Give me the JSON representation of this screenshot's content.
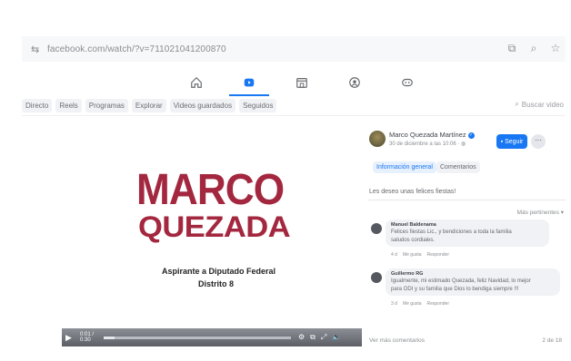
{
  "browser": {
    "url": "facebook.com/watch/?v=711021041200870",
    "icons": [
      "site-settings-icon",
      "install-app-icon",
      "zoom-icon",
      "bookmark-star-icon"
    ]
  },
  "topnav": {
    "items": [
      {
        "icon": "home-icon",
        "active": false
      },
      {
        "icon": "watch-icon",
        "active": true
      },
      {
        "icon": "marketplace-icon",
        "active": false
      },
      {
        "icon": "groups-icon",
        "active": false
      },
      {
        "icon": "gaming-icon",
        "active": false
      }
    ]
  },
  "tabs": {
    "items": [
      "Directo",
      "Reels",
      "Programas",
      "Explorar",
      "Videos guardados",
      "Seguidos"
    ],
    "search_placeholder": "Buscar video"
  },
  "video": {
    "title_line1": "MARCO",
    "title_line2": "QUEZADA",
    "subtitle_line1": "Aspirante a Diputado Federal",
    "subtitle_line2": "Distrito 8",
    "time": "0:01 / 0:30",
    "progress": 0.06,
    "accent_color": "#a3283f"
  },
  "panel": {
    "author": "Marco Quezada Martínez",
    "date": "30 de diciembre a las 10:06 · ",
    "follow_label": "Seguir",
    "more_label": "···",
    "tab_info": "Información general",
    "tab_comments": "Comentarios",
    "description": "Les deseo unas felices fiestas!",
    "sort_label": "Más pertinentes ▾",
    "comments": [
      {
        "name": "Manuel Baldenama",
        "text": "Felices fiestas Lic., y bendiciones a toda la familia",
        "text2": "saludos cordiales.",
        "meta_time": "4 d",
        "meta_like": "Me gusta",
        "meta_reply": "Responder"
      },
      {
        "name": "Guillermo RG",
        "text": "Igualmente, mi estimado Quezada, feliz Navidad, lo mejor",
        "text2": "para ODI y su familia que Dios lo bendiga siempre !!!",
        "meta_time": "3 d",
        "meta_like": "Me gusta",
        "meta_reply": "Responder"
      }
    ],
    "view_more": "Ver más comentarios",
    "count": "2 de 18"
  }
}
